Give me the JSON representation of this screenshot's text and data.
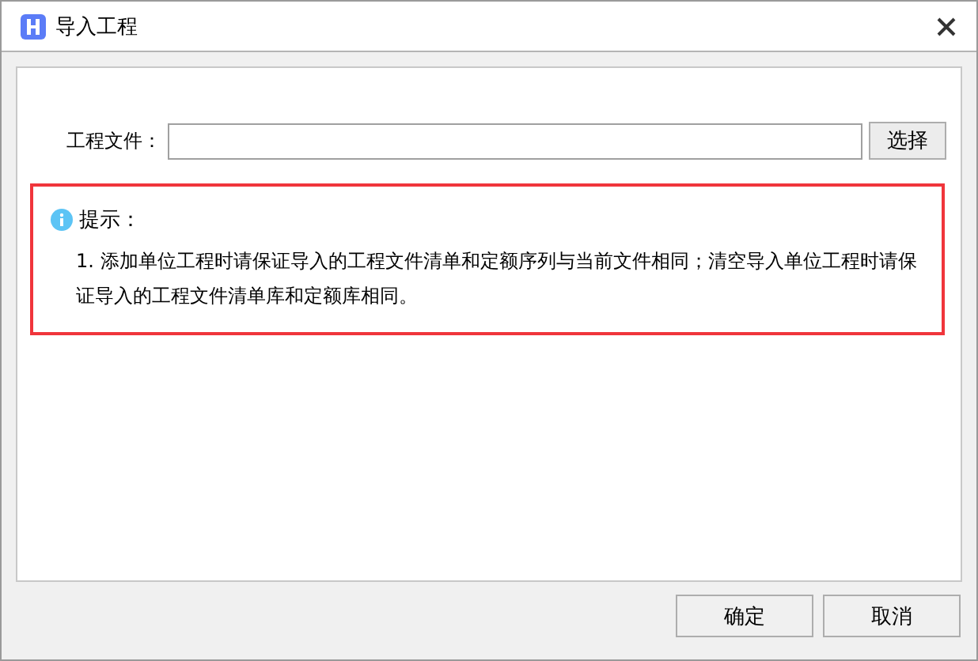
{
  "window": {
    "title": "导入工程"
  },
  "file_field": {
    "label": "工程文件："
  },
  "browse_button": "选择",
  "notice": {
    "title": "提示：",
    "text": "1. 添加单位工程时请保证导入的工程文件清单和定额序列与当前文件相同；清空导入单位工程时请保证导入的工程文件清单库和定额库相同。"
  },
  "buttons": [
    "确定",
    "取消"
  ]
}
